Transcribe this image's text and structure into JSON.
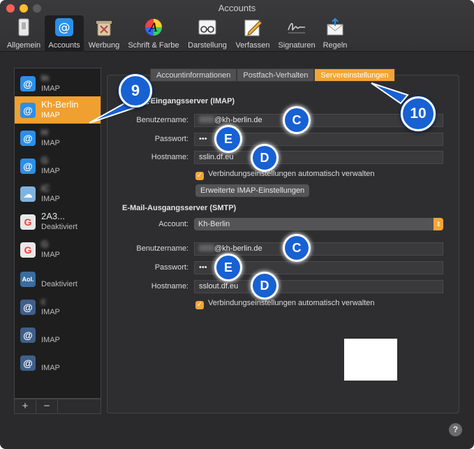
{
  "window": {
    "title": "Accounts"
  },
  "toolbar": {
    "items": [
      {
        "label": "Allgemein",
        "icon": "switch-icon"
      },
      {
        "label": "Accounts",
        "icon": "at-sign-icon"
      },
      {
        "label": "Werbung",
        "icon": "junk-bin-icon"
      },
      {
        "label": "Schrift & Farbe",
        "icon": "font-color-icon"
      },
      {
        "label": "Darstellung",
        "icon": "glasses-icon"
      },
      {
        "label": "Verfassen",
        "icon": "pencil-paper-icon"
      },
      {
        "label": "Signaturen",
        "icon": "signature-icon"
      },
      {
        "label": "Regeln",
        "icon": "envelope-rules-icon"
      }
    ]
  },
  "accounts": [
    {
      "name": "In",
      "type": "IMAP",
      "icon": "@",
      "color": "#2b8fe8"
    },
    {
      "name": "Kh-Berlin",
      "type": "IMAP",
      "icon": "@",
      "color": "#2b8fe8"
    },
    {
      "name": "H",
      "type": "IMAP",
      "icon": "@",
      "color": "#2b8fe8"
    },
    {
      "name": "G",
      "type": "IMAP",
      "icon": "@",
      "color": "#2b8fe8"
    },
    {
      "name": "iC",
      "type": "IMAP",
      "icon": "☁",
      "color": "#7fb3e0"
    },
    {
      "name": "2A3...",
      "type": "Deaktiviert",
      "icon": "G",
      "color": "#e8e8e8"
    },
    {
      "name": "G",
      "type": "IMAP",
      "icon": "G",
      "color": "#e8e8e8"
    },
    {
      "name": "",
      "type": "Deaktiviert",
      "icon": "Aol.",
      "color": "#3a6d9e"
    },
    {
      "name": "c",
      "type": "IMAP",
      "icon": "@",
      "color": "#3f5f8a"
    },
    {
      "name": "",
      "type": "IMAP",
      "icon": "@",
      "color": "#3f5f8a"
    },
    {
      "name": "",
      "type": "IMAP",
      "icon": "@",
      "color": "#3f5f8a"
    }
  ],
  "list_controls": {
    "add": "+",
    "remove": "−"
  },
  "tabs": [
    "Accountinformationen",
    "Postfach-Verhalten",
    "Servereinstellungen"
  ],
  "incoming": {
    "title": "-Eingangsserver (IMAP)",
    "username_label": "Benutzername:",
    "username_value": "@kh-berlin.de",
    "password_label": "Passwort:",
    "password_value": "•••",
    "hostname_label": "Hostname:",
    "hostname_value": "sslin.df.eu",
    "auto_manage": "Verbindungseinstellungen automatisch verwalten",
    "advanced_button": "Erweiterte IMAP-Einstellungen"
  },
  "outgoing": {
    "title": "E-Mail-Ausgangsserver (SMTP)",
    "account_label": "Account:",
    "account_value": "Kh-Berlin",
    "username_label": "Benutzername:",
    "username_value": "@kh-berlin.de",
    "password_label": "Passwort:",
    "password_value": "•••",
    "hostname_label": "Hostname:",
    "hostname_value": "sslout.df.eu",
    "auto_manage": "Verbindungseinstellungen automatisch verwalten"
  },
  "callouts": {
    "nine": "9",
    "ten": "10",
    "c": "C",
    "d": "D",
    "e": "E"
  },
  "help": "?",
  "colors": {
    "accent": "#f3a534",
    "marker": "#1761d3",
    "window": "#2a2a2c"
  }
}
